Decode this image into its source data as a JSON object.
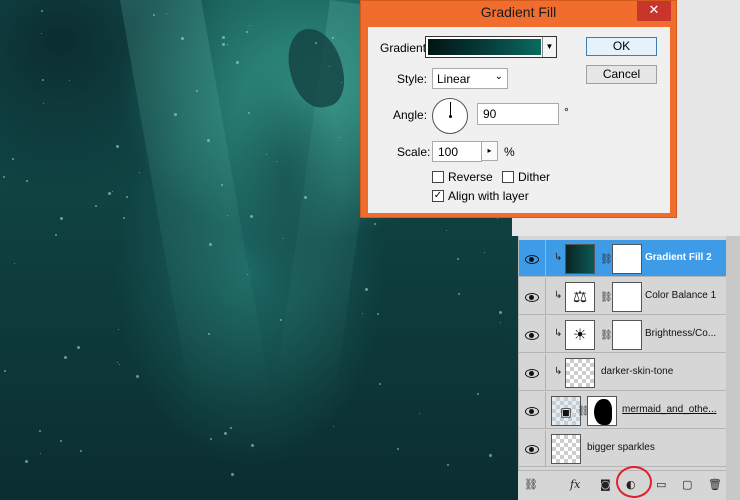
{
  "dialog": {
    "title": "Gradient Fill",
    "close_glyph": "✕",
    "gradient_label": "Gradient:",
    "style_label": "Style:",
    "style_value": "Linear",
    "angle_label": "Angle:",
    "angle_value": "90",
    "angle_unit": "°",
    "scale_label": "Scale:",
    "scale_value": "100",
    "scale_unit": "%",
    "reverse_label": "Reverse",
    "reverse_checked": false,
    "dither_label": "Dither",
    "dither_checked": false,
    "align_label": "Align with layer",
    "align_checked": true,
    "ok_label": "OK",
    "cancel_label": "Cancel",
    "gradient_colors": [
      "#021414",
      "#06403c",
      "#0b6a5f"
    ]
  },
  "layers": {
    "rows": [
      {
        "name": "Gradient Fill 2",
        "selected": true,
        "clipped": true,
        "thumb": "gradient-icon"
      },
      {
        "name": "Color Balance 1",
        "selected": false,
        "clipped": true,
        "thumb": "balance-icon"
      },
      {
        "name": "Brightness/Co...",
        "selected": false,
        "clipped": true,
        "thumb": "sun-icon"
      },
      {
        "name": "darker-skin-tone",
        "selected": false,
        "clipped": true,
        "thumb": "checker"
      },
      {
        "name": "mermaid_and_othe...",
        "selected": false,
        "clipped": false,
        "thumb": "smart-object"
      },
      {
        "name": "bigger sparkles",
        "selected": false,
        "clipped": false,
        "thumb": "checker"
      }
    ],
    "footer_icons": [
      "link-icon",
      "fx-icon",
      "mask-icon",
      "adjustment-icon",
      "group-icon",
      "new-layer-icon",
      "trash-icon"
    ],
    "fx_label": "fx"
  },
  "colors": {
    "dialog_frame": "#f16d2e",
    "selected_layer": "#3e9be8",
    "highlight_circle": "#e0202a"
  }
}
